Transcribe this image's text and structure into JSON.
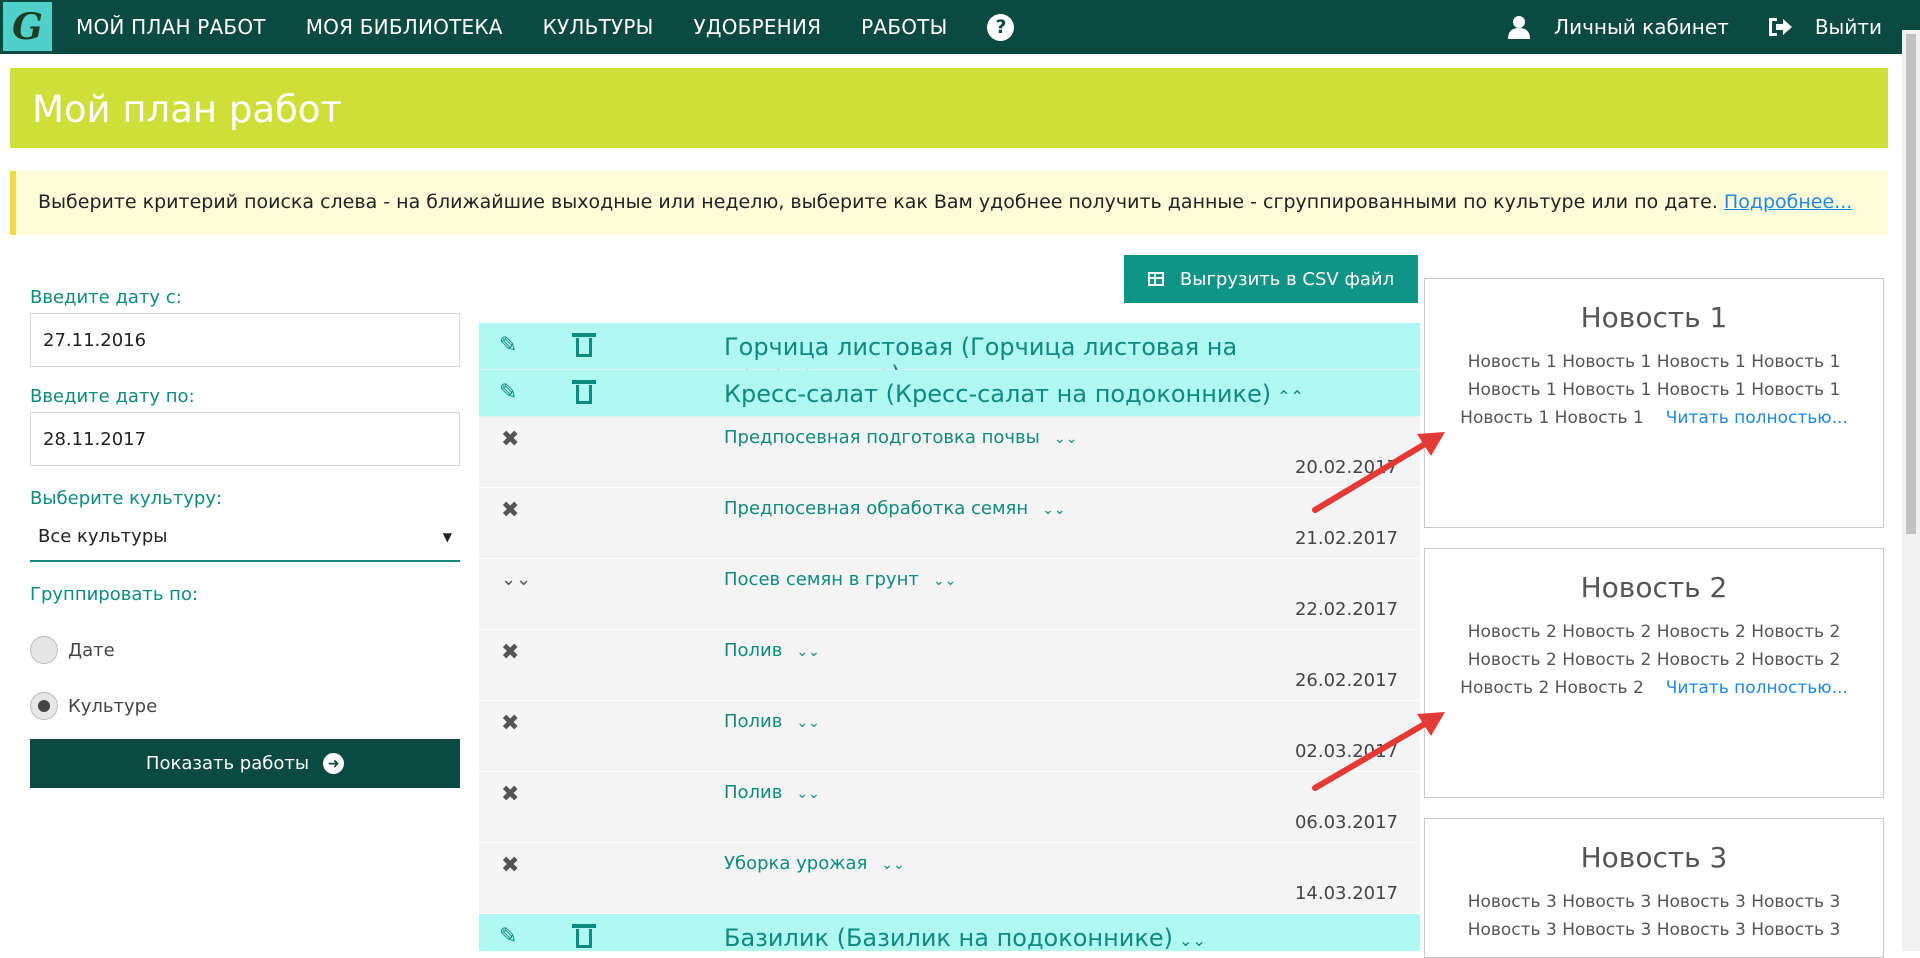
{
  "app": {
    "logo_letter": "G"
  },
  "nav": {
    "items": [
      "МОЙ ПЛАН РАБОТ",
      "МОЯ БИБЛИОТЕКА",
      "КУЛЬТУРЫ",
      "УДОБРЕНИЯ",
      "РАБОТЫ"
    ],
    "help": "?",
    "account": "Личный кабинет",
    "logout": "Выйти"
  },
  "page": {
    "title": "Мой план работ",
    "info_text": "Выберите критерий поиска слева - на ближайшие выходные или неделю, выберите как Вам удобнее получить данные - сгруппированными по культуре или по дате.",
    "info_link": "Подробнее..."
  },
  "filters": {
    "date_from_label": "Введите дату с:",
    "date_from_value": "27.11.2016",
    "date_to_label": "Введите дату по:",
    "date_to_value": "28.11.2017",
    "culture_label": "Выберите культуру:",
    "culture_value": "Все культуры",
    "group_label": "Группировать по:",
    "group_options": [
      "Дате",
      "Культуре"
    ],
    "group_selected": "Культуре",
    "show_button": "Показать работы"
  },
  "csv_button": "Выгрузить в CSV файл",
  "crops": [
    {
      "title": "Горчица листовая (Горчица листовая на подоконнике)",
      "expanded": false
    },
    {
      "title": "Кресс-салат (Кресс-салат на подоконнике)",
      "expanded": true
    },
    {
      "title": "Базилик (Базилик на подоконнике)",
      "expanded": false
    }
  ],
  "tasks": [
    {
      "name": "Предпосевная подготовка почвы",
      "date": "20.02.2017",
      "icon": "close-icon"
    },
    {
      "name": "Предпосевная обработка семян",
      "date": "21.02.2017",
      "icon": "close-icon"
    },
    {
      "name": "Посев семян в грунт",
      "date": "22.02.2017",
      "icon": "double-chevron-icon"
    },
    {
      "name": "Полив",
      "date": "26.02.2017",
      "icon": "close-icon"
    },
    {
      "name": "Полив",
      "date": "02.03.2017",
      "icon": "close-icon"
    },
    {
      "name": "Полив",
      "date": "06.03.2017",
      "icon": "close-icon"
    },
    {
      "name": "Уборка урожая",
      "date": "14.03.2017",
      "icon": "close-icon"
    }
  ],
  "news": [
    {
      "title": "Новость 1",
      "lines": [
        "Новость 1 Новость 1 Новость 1 Новость 1",
        "Новость 1 Новость 1 Новость 1 Новость 1",
        "Новость 1 Новость 1"
      ],
      "read_more": "Читать полностью..."
    },
    {
      "title": "Новость 2",
      "lines": [
        "Новость 2 Новость 2 Новость 2 Новость 2",
        "Новость 2 Новость 2 Новость 2 Новость 2",
        "Новость 2 Новость 2"
      ],
      "read_more": "Читать полностью..."
    },
    {
      "title": "Новость 3",
      "lines": [
        "Новость 3 Новость 3 Новость 3 Новость 3",
        "Новость 3 Новость 3 Новость 3 Новость 3"
      ],
      "read_more": ""
    }
  ],
  "colors": {
    "nav_bg": "#0b4a40",
    "banner": "#cddf38",
    "accent": "#0e8b7d",
    "crop_bg": "#b0f8f2",
    "arrow": "#e53935"
  }
}
